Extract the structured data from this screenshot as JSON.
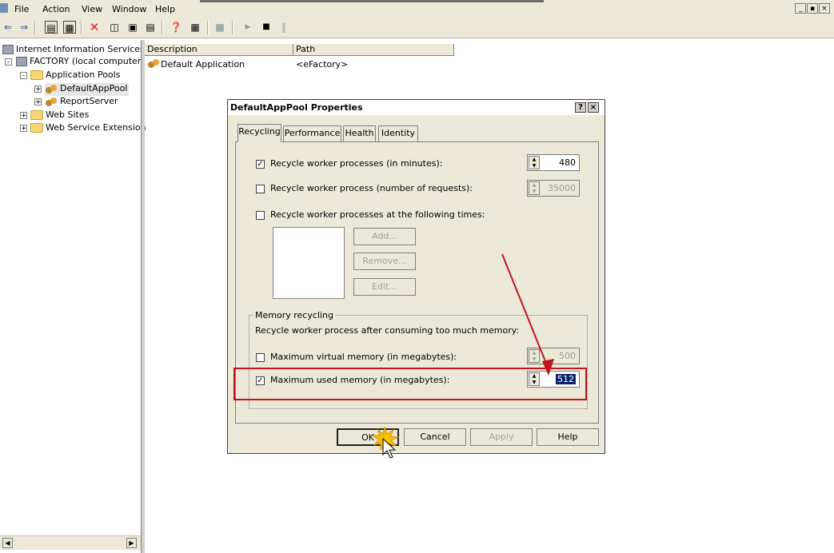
{
  "menubar": {
    "items": [
      "File",
      "Action",
      "View",
      "Window",
      "Help"
    ],
    "window_controls": [
      "_",
      "▪",
      "×"
    ]
  },
  "tree": {
    "root": "Internet Information Services",
    "computer": "FACTORY (local computer)",
    "app_pools": "Application Pools",
    "pool1": "DefaultAppPool",
    "pool2": "ReportServer",
    "web_sites": "Web Sites",
    "wse": "Web Service Extension"
  },
  "list": {
    "columns": [
      "Description",
      "Path"
    ],
    "rows": [
      {
        "description": "Default Application",
        "path": "<eFactory>"
      }
    ]
  },
  "dialog": {
    "title": "DefaultAppPool Properties",
    "help_btn": "?",
    "close_btn": "×",
    "tabs": [
      "Recycling",
      "Performance",
      "Health",
      "Identity"
    ],
    "active_tab": "Recycling",
    "recycle_minutes": {
      "label": "Recycle worker processes (in minutes):",
      "checked": true,
      "value": "480"
    },
    "recycle_requests": {
      "label": "Recycle worker process (number of requests):",
      "checked": false,
      "value": "35000"
    },
    "recycle_times": {
      "label": "Recycle worker processes at the following times:",
      "checked": false
    },
    "add_btn": "Add...",
    "remove_btn": "Remove...",
    "edit_btn": "Edit...",
    "memory_group": "Memory recycling",
    "memory_desc": "Recycle worker process after consuming too much memory:",
    "max_virtual": {
      "label": "Maximum virtual memory (in megabytes):",
      "checked": false,
      "value": "500"
    },
    "max_used": {
      "label": "Maximum used memory (in megabytes):",
      "checked": true,
      "value": "512"
    },
    "ok_btn": "OK",
    "cancel_btn": "Cancel",
    "apply_btn": "Apply",
    "help_footer_btn": "Help"
  },
  "colors": {
    "annotation": "#c0141e",
    "selection": "#0a246a"
  }
}
